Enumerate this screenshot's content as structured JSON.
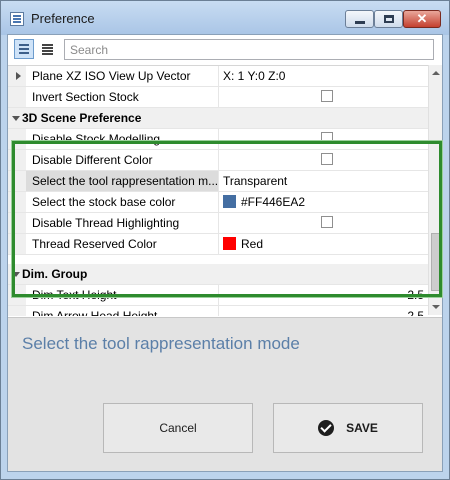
{
  "window": {
    "title": "Preference",
    "close_glyph": "✕"
  },
  "toolbar": {
    "search_placeholder": "Search"
  },
  "grid": {
    "rows": [
      {
        "type": "property",
        "name": "Plane XZ ISO View Up Vector",
        "value": "X: 1 Y:0 Z:0",
        "expandable": true
      },
      {
        "type": "property",
        "name": "Invert Section Stock",
        "checkbox": false
      },
      {
        "type": "category",
        "name": "3D Scene Preference",
        "expanded": true
      },
      {
        "type": "property",
        "name": "Disable Stock Modelling",
        "checkbox": false
      },
      {
        "type": "property",
        "name": "Disable Different Color",
        "checkbox": false
      },
      {
        "type": "property",
        "name": "Select the tool rappresentation m...",
        "value": "Transparent",
        "selected": true
      },
      {
        "type": "property",
        "name": "Select the stock base color",
        "value": "#FF446EA2",
        "swatch": "#446EA2"
      },
      {
        "type": "property",
        "name": "Disable Thread Highlighting",
        "checkbox": false
      },
      {
        "type": "property",
        "name": "Thread Reserved Color",
        "value": "Red",
        "swatch": "#FF0000"
      },
      {
        "type": "category",
        "name": "Dim. Group",
        "expanded": true
      },
      {
        "type": "property",
        "name": "Dim Text Height",
        "value": "2.5"
      },
      {
        "type": "property",
        "name": "Dim Arrow Head Height",
        "value": "2.5"
      }
    ]
  },
  "description": {
    "text": "Select the tool rappresentation mode"
  },
  "footer": {
    "cancel_label": "Cancel",
    "save_label": "SAVE"
  },
  "colors": {
    "highlight_border": "#2E8B2E",
    "description_text": "#5B7FA8"
  }
}
